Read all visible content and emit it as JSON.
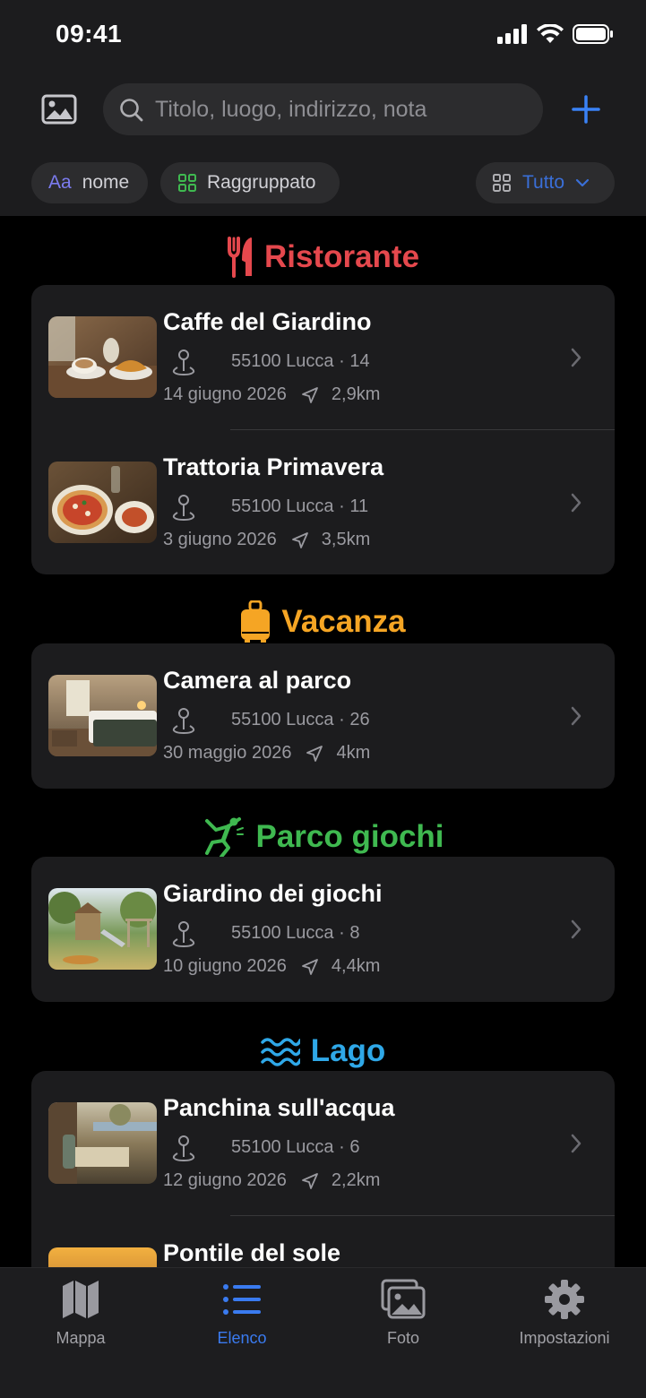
{
  "status_bar": {
    "time": "09:41"
  },
  "search": {
    "placeholder": "Titolo, luogo, indirizzo, nota"
  },
  "chips": {
    "sort_prefix": "Aa",
    "sort_label": "nome",
    "group_label": "Raggruppato",
    "filter_label": "Tutto"
  },
  "sections": [
    {
      "title": "Ristorante",
      "color": "#e5484d",
      "icon": "fork-knife-icon",
      "items": [
        {
          "title": "Caffe del Giardino",
          "address": "55100 Lucca · 14",
          "date": "14 giugno 2026",
          "distance": "2,9km"
        },
        {
          "title": "Trattoria Primavera",
          "address": "55100 Lucca · 11",
          "date": "3 giugno 2026",
          "distance": "3,5km"
        }
      ]
    },
    {
      "title": "Vacanza",
      "color": "#f5a524",
      "icon": "suitcase-icon",
      "items": [
        {
          "title": "Camera al parco",
          "address": "55100 Lucca · 26",
          "date": "30 maggio 2026",
          "distance": "4km"
        }
      ]
    },
    {
      "title": "Parco giochi",
      "color": "#3fb950",
      "icon": "jumping-figure-icon",
      "items": [
        {
          "title": "Giardino dei giochi",
          "address": "55100 Lucca · 8",
          "date": "10 giugno 2026",
          "distance": "4,4km"
        }
      ]
    },
    {
      "title": "Lago",
      "color": "#2fa8e8",
      "icon": "water-waves-icon",
      "items": [
        {
          "title": "Panchina sull'acqua",
          "address": "55100 Lucca · 6",
          "date": "12 giugno 2026",
          "distance": "2,2km"
        },
        {
          "title": "Pontile del sole"
        }
      ]
    }
  ],
  "tabs": [
    {
      "label": "Mappa",
      "icon": "map-icon"
    },
    {
      "label": "Elenco",
      "icon": "list-icon",
      "active": true
    },
    {
      "label": "Foto",
      "icon": "photos-icon"
    },
    {
      "label": "Impostazioni",
      "icon": "gear-icon"
    }
  ],
  "colors": {
    "accent": "#3a7bf0",
    "card": "#1c1c1e",
    "background": "#000000"
  }
}
